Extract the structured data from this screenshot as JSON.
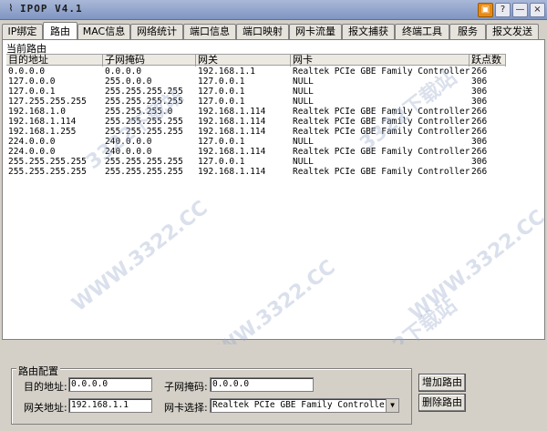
{
  "window": {
    "title": "IPOP V4.1",
    "app_icon": "antenna-icon",
    "controls": {
      "menu": "▣",
      "help": "?",
      "minimize": "—",
      "close": "×"
    }
  },
  "tabs": [
    {
      "label": "IP绑定",
      "active": false
    },
    {
      "label": "路由",
      "active": true
    },
    {
      "label": "MAC信息",
      "active": false
    },
    {
      "label": "网络统计",
      "active": false
    },
    {
      "label": "端口信息",
      "active": false
    },
    {
      "label": "端口映射",
      "active": false
    },
    {
      "label": "网卡流量",
      "active": false
    },
    {
      "label": "报文捕获",
      "active": false
    },
    {
      "label": "终端工具",
      "active": false
    },
    {
      "label": "服务",
      "active": false
    },
    {
      "label": "报文发送",
      "active": false
    }
  ],
  "routes_panel": {
    "title": "当前路由",
    "columns": [
      "目的地址",
      "子网掩码",
      "网关",
      "网卡",
      "跃点数"
    ],
    "rows": [
      [
        "0.0.0.0",
        "0.0.0.0",
        "192.168.1.1",
        "Realtek PCIe GBE Family Controller",
        "266"
      ],
      [
        "127.0.0.0",
        "255.0.0.0",
        "127.0.0.1",
        "NULL",
        "306"
      ],
      [
        "127.0.0.1",
        "255.255.255.255",
        "127.0.0.1",
        "NULL",
        "306"
      ],
      [
        "127.255.255.255",
        "255.255.255.255",
        "127.0.0.1",
        "NULL",
        "306"
      ],
      [
        "192.168.1.0",
        "255.255.255.0",
        "192.168.1.114",
        "Realtek PCIe GBE Family Controller",
        "266"
      ],
      [
        "192.168.1.114",
        "255.255.255.255",
        "192.168.1.114",
        "Realtek PCIe GBE Family Controller",
        "266"
      ],
      [
        "192.168.1.255",
        "255.255.255.255",
        "192.168.1.114",
        "Realtek PCIe GBE Family Controller",
        "266"
      ],
      [
        "224.0.0.0",
        "240.0.0.0",
        "127.0.0.1",
        "NULL",
        "306"
      ],
      [
        "224.0.0.0",
        "240.0.0.0",
        "192.168.1.114",
        "Realtek PCIe GBE Family Controller",
        "266"
      ],
      [
        "255.255.255.255",
        "255.255.255.255",
        "127.0.0.1",
        "NULL",
        "306"
      ],
      [
        "255.255.255.255",
        "255.255.255.255",
        "192.168.1.114",
        "Realtek PCIe GBE Family Controller",
        "266"
      ]
    ]
  },
  "watermark": "3322下载站",
  "watermark2": "WWW.3322.CC",
  "route_config": {
    "legend": "路由配置",
    "dest_label": "目的地址:",
    "dest_value": "0.0.0.0",
    "mask_label": "子网掩码:",
    "mask_value": "0.0.0.0",
    "gateway_label": "网关地址:",
    "gateway_value": "192.168.1.1",
    "nic_label": "网卡选择:",
    "nic_value": "Realtek PCIe GBE Family Controller",
    "add_button": "增加路由",
    "delete_button": "删除路由"
  }
}
